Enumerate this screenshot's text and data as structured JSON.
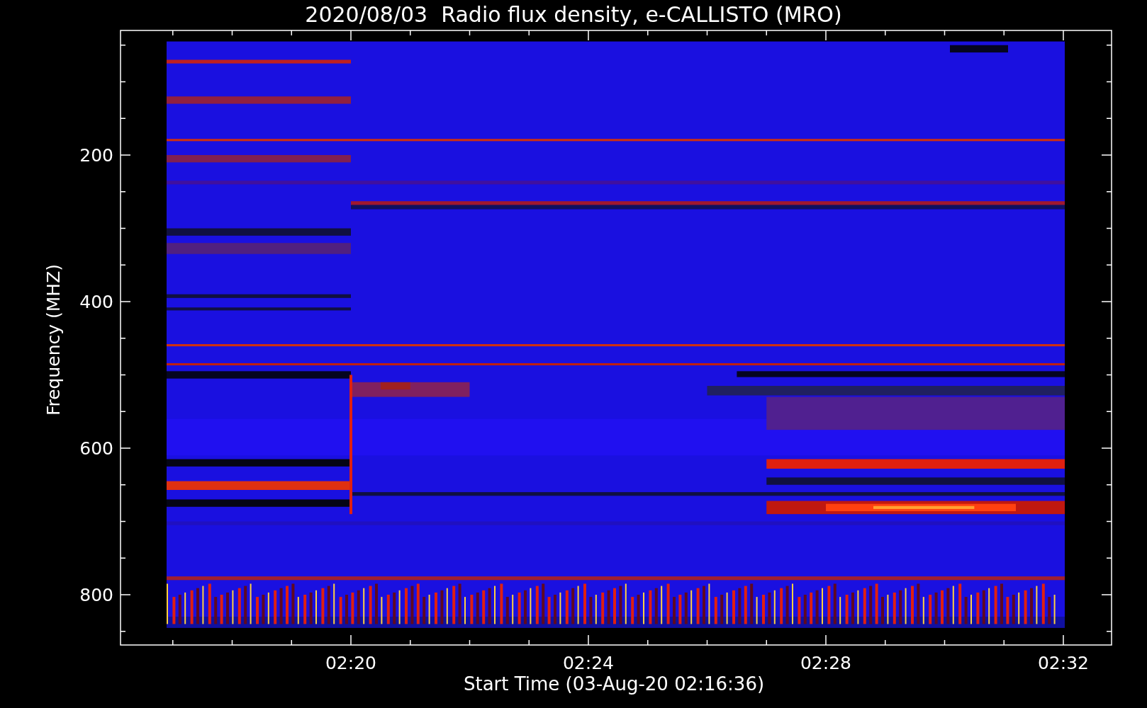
{
  "plot": {
    "title": "2020/08/03  Radio flux density, e-CALLISTO (MRO)",
    "ylabel": "Frequency (MHZ)",
    "xlabel": "Start Time (03-Aug-20 02:16:36)",
    "yticks": [
      "200",
      "400",
      "600",
      "800"
    ],
    "xticks": [
      "02:20",
      "02:24",
      "02:28",
      "02:32"
    ]
  }
}
